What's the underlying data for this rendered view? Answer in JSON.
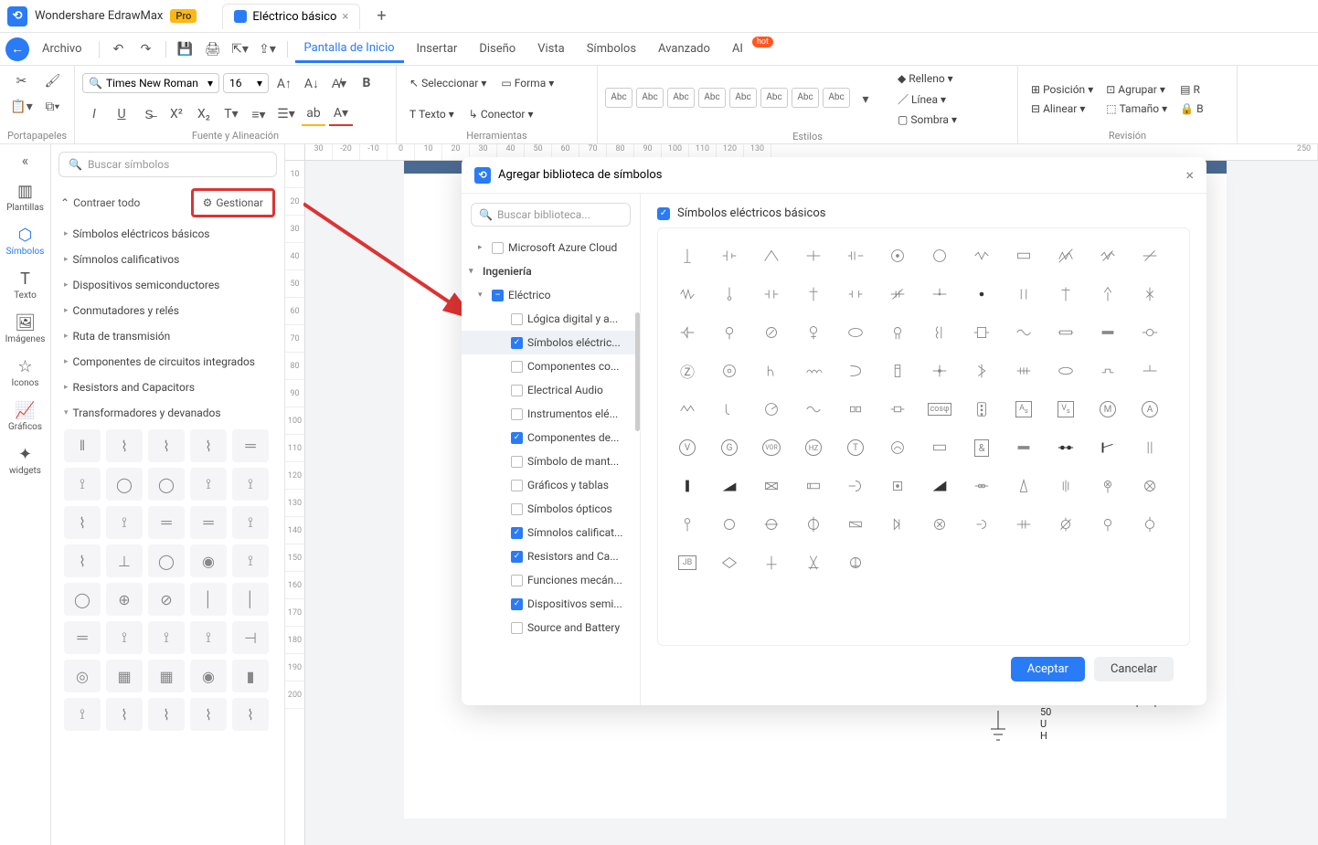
{
  "app": {
    "title": "Wondershare EdrawMax",
    "badge": "Pro"
  },
  "tab": {
    "title": "Eléctrico básico"
  },
  "menu": {
    "archivo": "Archivo",
    "items": [
      "Pantalla de Inicio",
      "Insertar",
      "Diseño",
      "Vista",
      "Símbolos",
      "Avanzado",
      "AI"
    ],
    "active": "Pantalla de Inicio",
    "hot": "hot"
  },
  "ribbon": {
    "portapapeles": "Portapapeles",
    "fuente": "Fuente y Alineación",
    "font_name": "Times New Roman",
    "font_size": "16",
    "herramientas": "Herramientas",
    "seleccionar": "Seleccionar",
    "forma": "Forma",
    "texto": "Texto",
    "conector": "Conector",
    "estilos": "Estilos",
    "abc": "Abc",
    "revision": "Revisión",
    "relleno": "Relleno",
    "linea": "Línea",
    "sombra": "Sombra",
    "posicion": "Posición",
    "alinear": "Alinear",
    "agrupar": "Agrupar",
    "tamano": "Tamaño",
    "r_label": "R",
    "b_label": "B"
  },
  "rail": {
    "plantillas": "Plantillas",
    "simbolos": "Símbolos",
    "texto": "Texto",
    "imagenes": "Imágenes",
    "iconos": "Iconos",
    "graficos": "Gráficos",
    "widgets": "widgets"
  },
  "panel": {
    "search_placeholder": "Buscar símbolos",
    "collapse": "Contraer todo",
    "manage": "Gestionar",
    "categories": [
      "Símbolos eléctricos básicos",
      "Símnolos calificativos",
      "Dispositivos semiconductores",
      "Conmutadores y relés",
      "Ruta de transmisión",
      "Componentes de circuitos integrados",
      "Resistors and Capacitors",
      "Transformadores y devanados"
    ]
  },
  "ruler_h": [
    "30",
    "-20",
    "-10",
    "0",
    "10",
    "20",
    "30",
    "40",
    "50",
    "60",
    "70",
    "80",
    "90",
    "100",
    "110",
    "120",
    "130",
    "250"
  ],
  "ruler_v": [
    "10",
    "20",
    "30",
    "40",
    "50",
    "60",
    "70",
    "80",
    "90",
    "100",
    "110",
    "120",
    "130",
    "140",
    "150",
    "160",
    "170",
    "180",
    "190",
    "200"
  ],
  "modal": {
    "title": "Agregar biblioteca de símbolos",
    "search_placeholder": "Buscar biblioteca...",
    "tree_top": "Microsoft Azure Cloud",
    "tree_ing": "Ingeniería",
    "tree_elec": "Eléctrico",
    "children": [
      {
        "label": "Lógica digital y a...",
        "checked": false
      },
      {
        "label": "Símbolos eléctric...",
        "checked": true,
        "selected": true
      },
      {
        "label": "Componentes co...",
        "checked": false
      },
      {
        "label": "Electrical Audio",
        "checked": false
      },
      {
        "label": "Instrumentos elé...",
        "checked": false
      },
      {
        "label": "Componentes de...",
        "checked": true
      },
      {
        "label": "Símbolo de mant...",
        "checked": false
      },
      {
        "label": "Gráficos y tablas",
        "checked": false
      },
      {
        "label": "Símbolos ópticos",
        "checked": false
      },
      {
        "label": "Símnolos calificat...",
        "checked": true
      },
      {
        "label": "Resistors and Ca...",
        "checked": true
      },
      {
        "label": "Funciones mecán...",
        "checked": false
      },
      {
        "label": "Dispositivos semi...",
        "checked": true
      },
      {
        "label": "Source and Battery",
        "checked": false
      }
    ],
    "right_title": "Símbolos eléctricos básicos",
    "accept": "Aceptar",
    "cancel": "Cancelar"
  },
  "under": {
    "val50": "50",
    "valU": "U",
    "valH": "H",
    "valJB": "JB"
  },
  "symbol_labels": {
    "V": "V",
    "G": "G",
    "VOR": "VOR",
    "HZ": "HZ",
    "T": "T",
    "A": "A",
    "M": "M",
    "S": "S",
    "cosp": "cosφ",
    "Z": "Z",
    "amp": "&"
  }
}
